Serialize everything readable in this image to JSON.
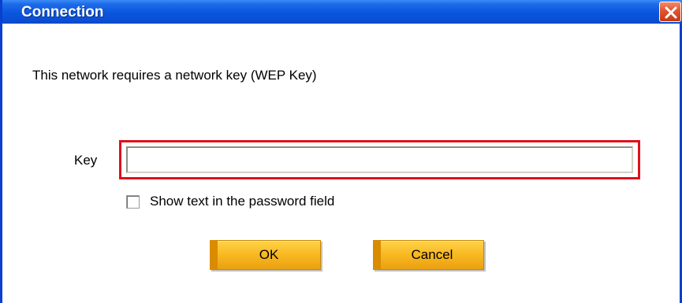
{
  "window": {
    "title": "Connection"
  },
  "dialog": {
    "message": "This network requires a network key (WEP Key)",
    "key_label": "Key",
    "key_value": "",
    "key_placeholder": "",
    "show_text_label": "Show text in the password field",
    "show_text_checked": false,
    "ok_label": "OK",
    "cancel_label": "Cancel"
  },
  "colors": {
    "titlebar": "#0a55dd",
    "close_button": "#e0532e",
    "highlight_border": "#e0101a",
    "button": "#f8b820"
  },
  "icons": {
    "close": "close-icon"
  }
}
